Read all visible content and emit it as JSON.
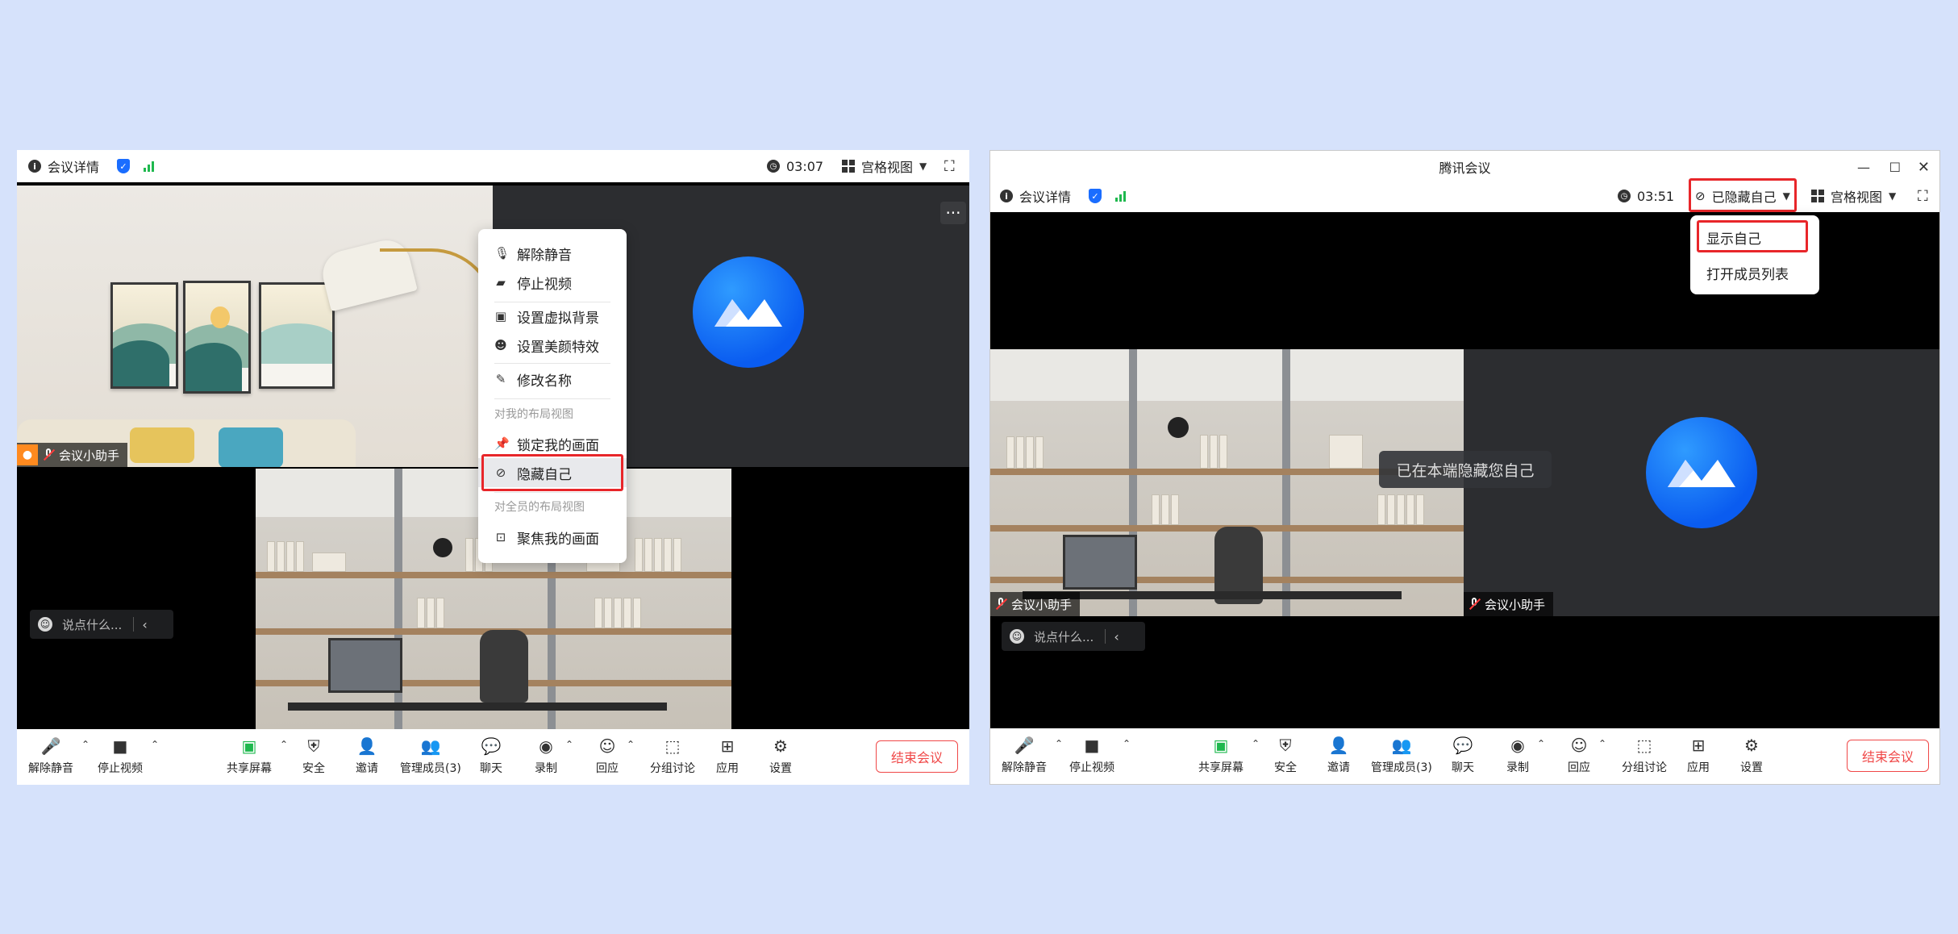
{
  "left": {
    "meeting_info": "会议详情",
    "timer": "03:07",
    "view_mode": "宫格视图",
    "participant_name_top": "会议小助手",
    "chat_placeholder": "说点什么...",
    "context_menu": {
      "items": [
        {
          "label": "解除静音",
          "icon": "microphone-icon"
        },
        {
          "label": "停止视频",
          "icon": "video-off-icon"
        },
        {
          "label": "设置虚拟背景",
          "icon": "portrait-icon"
        },
        {
          "label": "设置美颜特效",
          "icon": "face-icon"
        },
        {
          "label": "修改名称",
          "icon": "pencil-icon"
        }
      ],
      "section_self": "对我的布局视图",
      "self_items": [
        {
          "label": "锁定我的画面",
          "icon": "pin-icon"
        },
        {
          "label": "隐藏自己",
          "icon": "eye-off-icon"
        }
      ],
      "section_all": "对全员的布局视图",
      "all_items": [
        {
          "label": "聚焦我的画面",
          "icon": "focus-icon"
        }
      ]
    }
  },
  "right": {
    "window_title": "腾讯会议",
    "meeting_info": "会议详情",
    "timer": "03:51",
    "hidden_dropdown": "已隐藏自己",
    "view_mode": "宫格视图",
    "dropdown_items": [
      "显示自己",
      "打开成员列表"
    ],
    "toast": "已在本端隐藏您自己",
    "participant_name_left": "会议小助手",
    "participant_name_right": "会议小助手",
    "chat_placeholder": "说点什么..."
  },
  "toolbar": {
    "unmute": "解除静音",
    "stop_video": "停止视频",
    "share_screen": "共享屏幕",
    "security": "安全",
    "invite": "邀请",
    "manage_members": "管理成员(3)",
    "chat": "聊天",
    "record": "录制",
    "reactions": "回应",
    "breakout": "分组讨论",
    "apps": "应用",
    "settings": "设置",
    "end_meeting": "结束会议"
  },
  "colors": {
    "background": "#d6e2fb",
    "accent_blue": "#1a6dff",
    "highlight_red": "#e8262a",
    "end_red": "#f04848",
    "signal_green": "#1fb84e"
  }
}
